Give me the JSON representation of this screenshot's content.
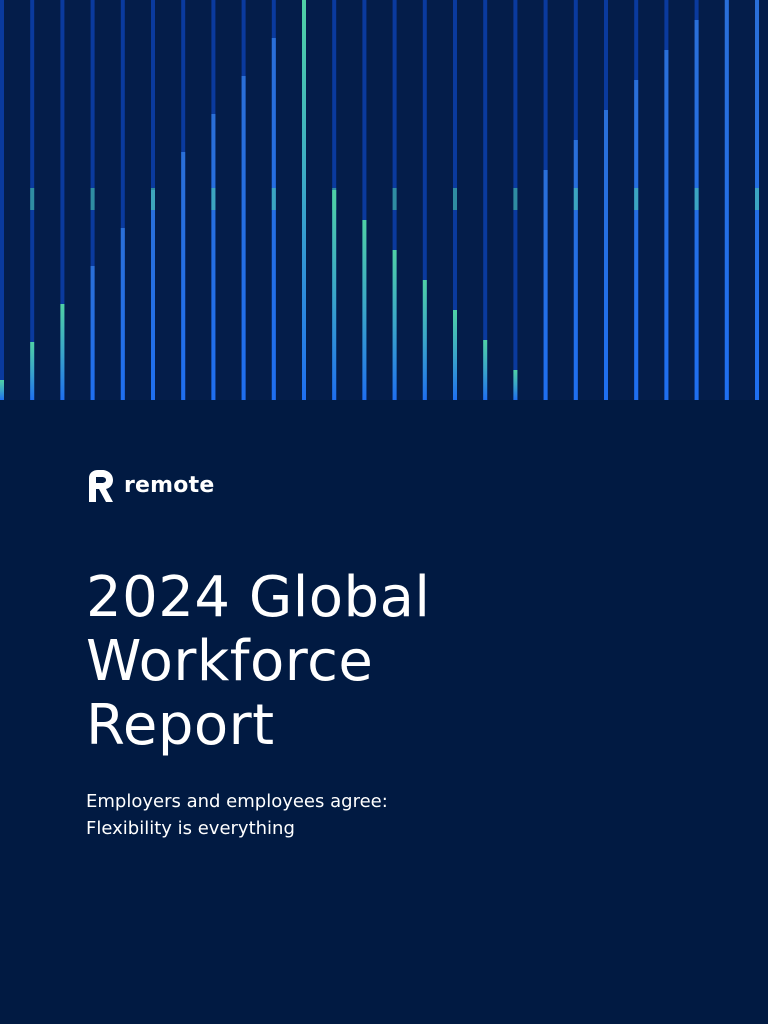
{
  "colors": {
    "background": "#011a42",
    "stripe_dark": "#0a3a9e",
    "stripe_bright": "#1f6ff0",
    "stripe_green": "#4fd1a5",
    "text": "#ffffff"
  },
  "logo": {
    "wordmark": "remote",
    "icon": "remote-r-logo-icon"
  },
  "cover": {
    "title_lines": [
      "2024 Global",
      "Workforce",
      "Report"
    ],
    "subtitle_lines": [
      "Employers and employees agree:",
      "Flexibility is everything"
    ]
  }
}
